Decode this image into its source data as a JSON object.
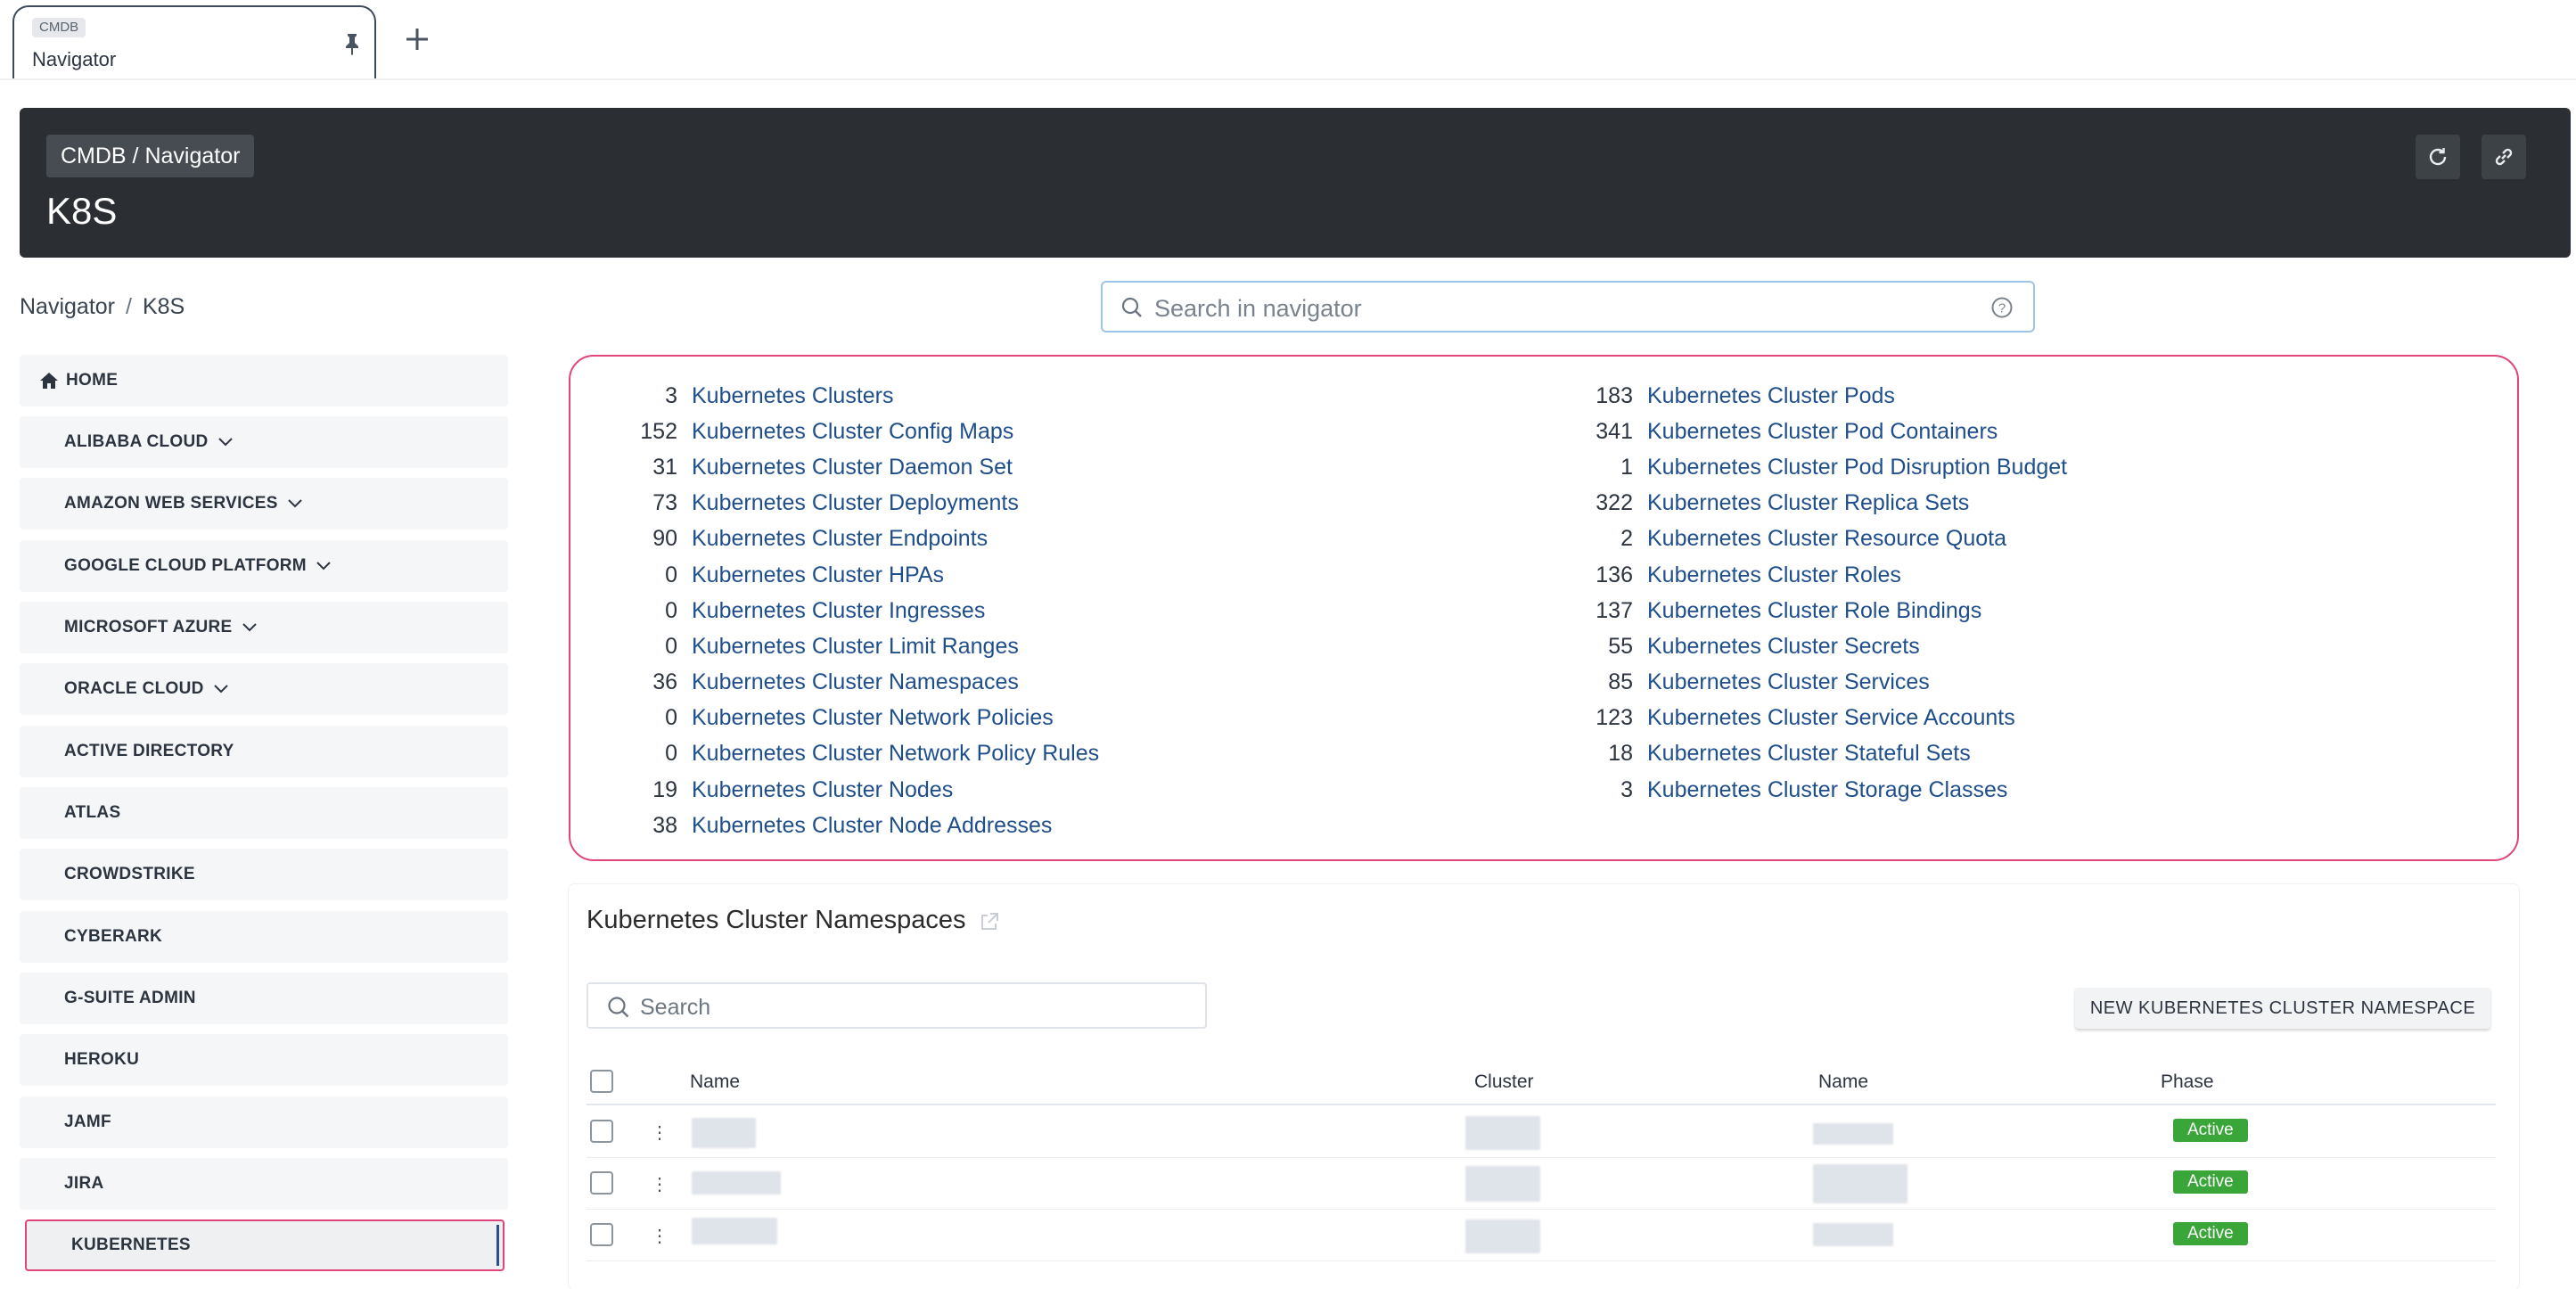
{
  "tab": {
    "badge": "CMDB",
    "title": "Navigator",
    "pin_icon": "pin-icon",
    "add_icon": "plus-icon"
  },
  "header": {
    "crumb": "CMDB / Navigator",
    "title": "K8S",
    "refresh_icon": "refresh-icon",
    "link_icon": "link-icon"
  },
  "breadcrumb": {
    "root": "Navigator",
    "sep": "/",
    "current": "K8S"
  },
  "search": {
    "placeholder": "Search in navigator",
    "value": ""
  },
  "sidebar": {
    "items": [
      {
        "label": "HOME",
        "icon": "home-icon"
      },
      {
        "label": "ALIBABA CLOUD",
        "chevron": true
      },
      {
        "label": "AMAZON WEB SERVICES",
        "chevron": true
      },
      {
        "label": "GOOGLE CLOUD PLATFORM",
        "chevron": true
      },
      {
        "label": "MICROSOFT AZURE",
        "chevron": true
      },
      {
        "label": "ORACLE CLOUD",
        "chevron": true
      },
      {
        "label": "ACTIVE DIRECTORY"
      },
      {
        "label": "ATLAS"
      },
      {
        "label": "CROWDSTRIKE"
      },
      {
        "label": "CYBERARK"
      },
      {
        "label": "G-SUITE ADMIN"
      },
      {
        "label": "HEROKU"
      },
      {
        "label": "JAMF"
      },
      {
        "label": "JIRA"
      },
      {
        "label": "KUBERNETES",
        "active": true
      }
    ]
  },
  "summary": {
    "left": [
      {
        "count": "3",
        "label": "Kubernetes Clusters"
      },
      {
        "count": "152",
        "label": "Kubernetes Cluster Config Maps"
      },
      {
        "count": "31",
        "label": "Kubernetes Cluster Daemon Set"
      },
      {
        "count": "73",
        "label": "Kubernetes Cluster Deployments"
      },
      {
        "count": "90",
        "label": "Kubernetes Cluster Endpoints"
      },
      {
        "count": "0",
        "label": "Kubernetes Cluster HPAs"
      },
      {
        "count": "0",
        "label": "Kubernetes Cluster Ingresses"
      },
      {
        "count": "0",
        "label": "Kubernetes Cluster Limit Ranges"
      },
      {
        "count": "36",
        "label": "Kubernetes Cluster Namespaces"
      },
      {
        "count": "0",
        "label": "Kubernetes Cluster Network Policies"
      },
      {
        "count": "0",
        "label": "Kubernetes Cluster Network Policy Rules"
      },
      {
        "count": "19",
        "label": "Kubernetes Cluster Nodes"
      },
      {
        "count": "38",
        "label": "Kubernetes Cluster Node Addresses"
      }
    ],
    "right": [
      {
        "count": "183",
        "label": "Kubernetes Cluster Pods"
      },
      {
        "count": "341",
        "label": "Kubernetes Cluster Pod Containers"
      },
      {
        "count": "1",
        "label": "Kubernetes Cluster Pod Disruption Budget"
      },
      {
        "count": "322",
        "label": "Kubernetes Cluster Replica Sets"
      },
      {
        "count": "2",
        "label": "Kubernetes Cluster Resource Quota"
      },
      {
        "count": "136",
        "label": "Kubernetes Cluster Roles"
      },
      {
        "count": "137",
        "label": "Kubernetes Cluster Role Bindings"
      },
      {
        "count": "55",
        "label": "Kubernetes Cluster Secrets"
      },
      {
        "count": "85",
        "label": "Kubernetes Cluster Services"
      },
      {
        "count": "123",
        "label": "Kubernetes Cluster Service Accounts"
      },
      {
        "count": "18",
        "label": "Kubernetes Cluster Stateful Sets"
      },
      {
        "count": "3",
        "label": "Kubernetes Cluster Storage Classes"
      }
    ]
  },
  "panel": {
    "title": "Kubernetes Cluster Namespaces",
    "search_placeholder": "Search",
    "new_button": "NEW KUBERNETES CLUSTER NAMESPACE",
    "columns": [
      "Name",
      "Cluster",
      "Name",
      "Phase"
    ],
    "rows": [
      {
        "phase": "Active"
      },
      {
        "phase": "Active"
      },
      {
        "phase": "Active"
      }
    ]
  },
  "colors": {
    "accent_link": "#1f4e8c",
    "highlight": "#e0447a",
    "status_active": "#3aa538",
    "header_bg": "#2b2f33"
  }
}
